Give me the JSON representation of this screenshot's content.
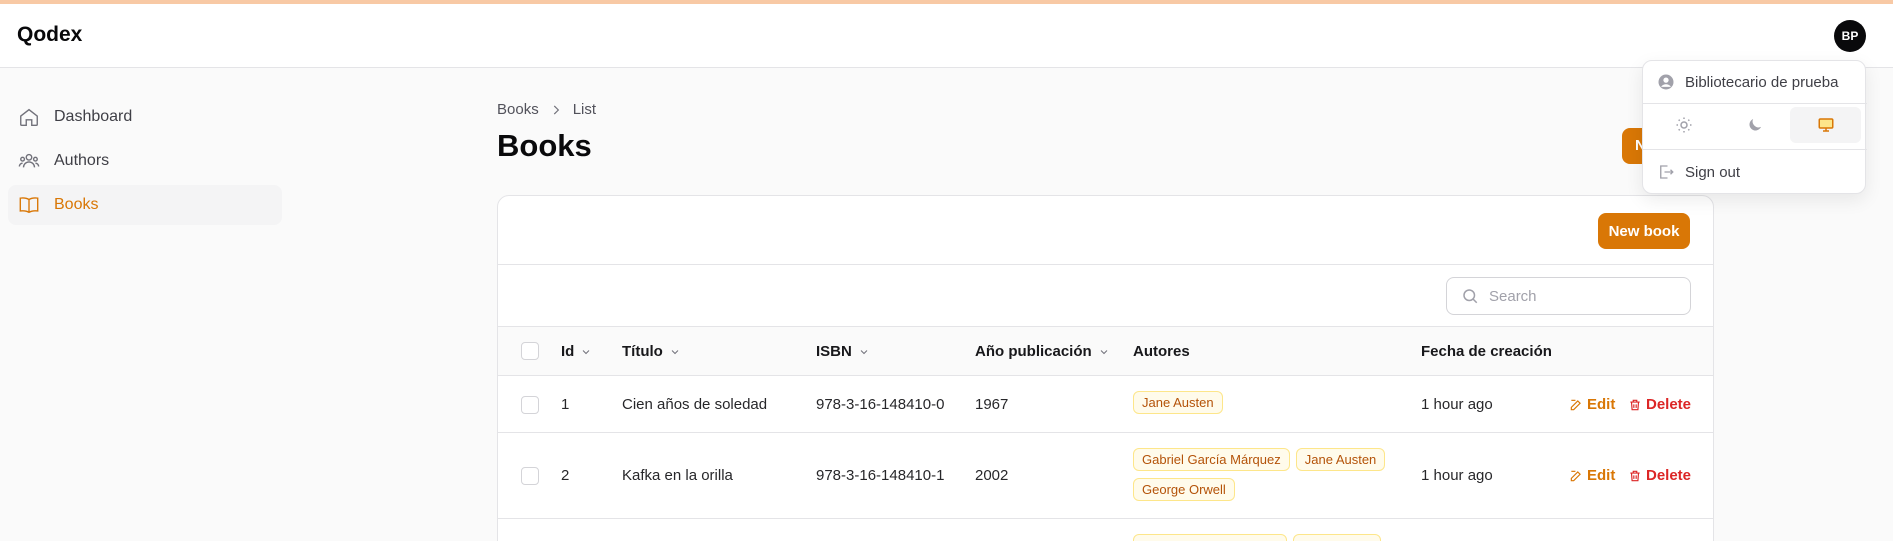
{
  "app": {
    "brand": "Qodex",
    "avatar_initials": "BP"
  },
  "sidebar": {
    "items": [
      {
        "label": "Dashboard",
        "icon": "home-icon",
        "active": false
      },
      {
        "label": "Authors",
        "icon": "users-icon",
        "active": false
      },
      {
        "label": "Books",
        "icon": "book-open-icon",
        "active": true
      }
    ]
  },
  "breadcrumb": {
    "parent": "Books",
    "current": "List"
  },
  "page": {
    "title": "Books",
    "header_action_label": "N"
  },
  "card": {
    "new_button": "New book",
    "search_placeholder": "Search"
  },
  "table": {
    "headers": {
      "id": "Id",
      "title": "Título",
      "isbn": "ISBN",
      "year": "Año publicación",
      "authors": "Autores",
      "created": "Fecha de creación"
    },
    "rows": [
      {
        "id": "1",
        "title": "Cien años de soledad",
        "isbn": "978-3-16-148410-0",
        "year": "1967",
        "authors": [
          "Jane Austen"
        ],
        "created": "1 hour ago"
      },
      {
        "id": "2",
        "title": "Kafka en la orilla",
        "isbn": "978-3-16-148410-1",
        "year": "2002",
        "authors": [
          "Gabriel García Márquez",
          "Jane Austen",
          "George Orwell"
        ],
        "created": "1 hour ago"
      }
    ],
    "actions": {
      "edit": "Edit",
      "delete": "Delete"
    }
  },
  "user_menu": {
    "user_name": "Bibliotecario de prueba",
    "theme_options": [
      "light-theme-icon",
      "dark-theme-icon",
      "system-theme-icon"
    ],
    "selected_theme": "system",
    "sign_out": "Sign out"
  },
  "colors": {
    "accent": "#d97706",
    "danger": "#dc2626",
    "badge_bg": "#fffbeb"
  }
}
